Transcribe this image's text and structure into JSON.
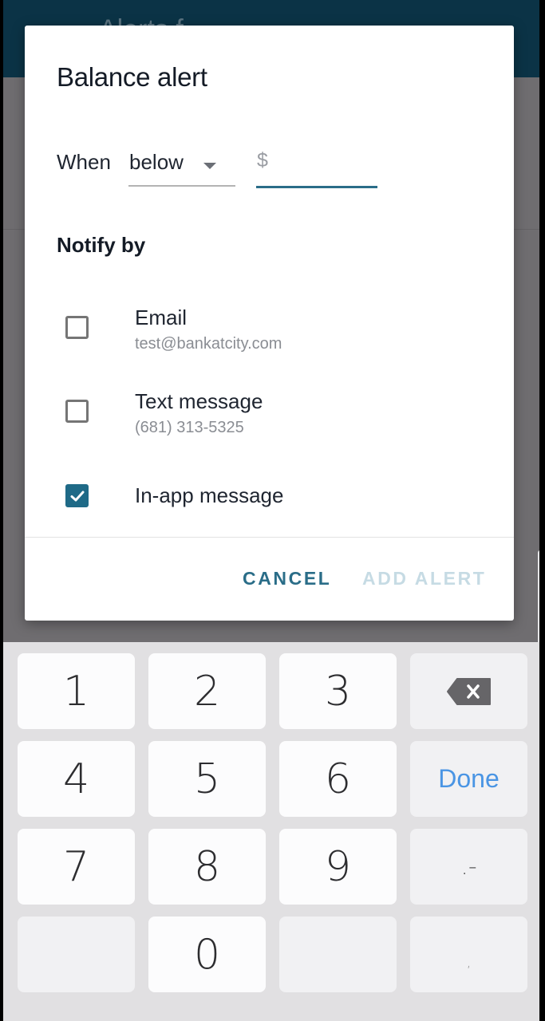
{
  "background": {
    "header_title": "Alerts f"
  },
  "dialog": {
    "title": "Balance alert",
    "condition": {
      "label": "When",
      "selected": "below",
      "currency_prefix": "$",
      "amount_value": "",
      "amount_placeholder": ""
    },
    "notify_heading": "Notify by",
    "options": [
      {
        "label": "Email",
        "detail": "test@bankatcity.com",
        "checked": false
      },
      {
        "label": "Text message",
        "detail": "(681) 313-5325",
        "checked": false
      },
      {
        "label": "In-app message",
        "detail": "",
        "checked": true
      }
    ],
    "actions": {
      "cancel": "CANCEL",
      "add": "ADD ALERT",
      "add_enabled": false
    }
  },
  "keyboard": {
    "keys": [
      "1",
      "2",
      "3",
      "backspace",
      "4",
      "5",
      "6",
      "Done",
      "7",
      "8",
      "9",
      ".-",
      "",
      "0",
      "",
      ","
    ],
    "done_label": "Done",
    "symbols_label": ".-",
    "comma_label": ","
  },
  "colors": {
    "accent": "#2a6d88",
    "accent_disabled": "#c6dbe4",
    "header": "#0b3346",
    "done": "#4a95e4"
  }
}
